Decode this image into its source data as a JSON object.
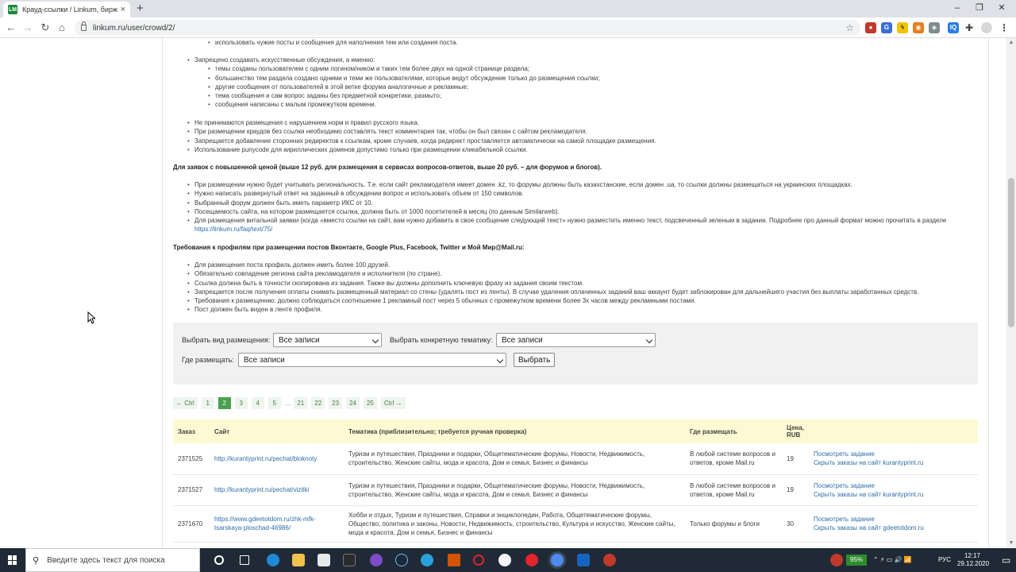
{
  "browser": {
    "tab_title": "Крауд-ссылки / Linkum, биржа",
    "url": "linkum.ru/user/crowd/2/",
    "favicon_text": "LM"
  },
  "page": {
    "top_bullet": "использовать чужие посты и сообщения для наполнения тем или создания поста.",
    "rule_artificial": "Запрещено создавать искусственные обсуждения, а именно:",
    "artificial_items": [
      "темы созданы пользователем с одним логином/ником и таких тем более двух на одной странице раздела;",
      "большинство тем раздела создано одними и теми же пользователями, которые ведут обсуждение только до размещения ссылки;",
      "другие сообщения от пользователей в этой ветке форума аналогичные и рекламные;",
      "тема сообщения и сам вопрос заданы без предметной конкретики, размыто;",
      "сообщения написаны с малым промежутком времени."
    ],
    "general_rules": [
      "Не принимаются размещения с нарушением норм и правил русского языка.",
      "При размещении краудов без ссылки необходимо составлять текст комментария так, чтобы он был связан с сайтом рекламодателя.",
      "Запрещается добавление сторонних редиректов к ссылкам, кроме случаев, когда редирект проставляется автоматически на самой площадке размещения.",
      "Использование punycode для кириллических доменов допустимо только при размещении кликабельной ссылки."
    ],
    "premium_heading": "Для заявок с повышенной ценой (выше 12 руб.  для размещения в сервисах вопросов-ответов, выше 20 руб. – для форумов и блогов).",
    "premium_rules": [
      "При размещении нужно будет учитывать региональность. Т.е. если сайт рекламодателя имеет домен .kz, то форумы должны быть казахстанские, если домен .ua, то ссылки должны размещаться на украинских площадках.",
      "Нужно написать развернутый ответ на заданный в обсуждении вопрос и использовать объем от 150 символов.",
      "Выбранный форум должен быть иметь параметр ИКС от 10.",
      "Посещаемость сайта, на котором размещается ссылка, должна быть от 1000 посетителей в месяц (по данным Similarweb)."
    ],
    "premium_last": "Для размещения витальной заявки (когда «вместо ссылки на сайт, вам нужно добавить в свое сообщение следующий текст» нужно разместить именно текст, подсвеченный зеленым в задании. Подробнее про данный формат можно прочитать в разделе",
    "premium_link": "https://linkum.ru/faq/text/75/",
    "social_heading": "Требования к  профилям при размещении постов Вконтакте, Google Plus, Facebook, Twitter и Мой Мир@Mail.ru:",
    "social_rules": [
      "Для размещения поста профиль должен иметь более 100 друзей.",
      "Обязательно совпадение региона сайта рекламодателя и исполнителя (по стране).",
      "Ссылка должна быть в точности скопирована из задания. Также вы должны дополнить ключевую фразу из задания своим текстом.",
      "Запрещается после получения оплаты снимать размещенный материал со стены (удалять пост из ленты). В случае удаления оплаченных заданий ваш аккаунт будет заблокирован для дальнейшего участия без выплаты заработанных средств.",
      "Требования к размещению: должно соблюдаться соотношение 1 рекламный пост через 5 обычных с промежутком времени более 3х часов между рекламными постами.",
      "Пост должен быть виден в ленте профиля."
    ]
  },
  "filters": {
    "type_label": "Выбрать вид размещения:",
    "type_value": "Все записи",
    "topic_label": "Выбрать конкретную тематику:",
    "topic_value": "Все записи",
    "where_label": "Где размещать:",
    "where_value": "Все записи",
    "submit_label": "Выбрать"
  },
  "pager": {
    "prev": "← Ctrl",
    "pages": [
      "1",
      "2",
      "3",
      "4",
      "5"
    ],
    "dots": "...",
    "pages2": [
      "21",
      "22",
      "23",
      "24",
      "25"
    ],
    "next": "Ctrl →",
    "active": "2"
  },
  "table": {
    "headers": {
      "order": "Заказ",
      "site": "Сайт",
      "topic": "Тематика (приблизительно; требуется ручная проверка)",
      "where": "Где размещать",
      "price": "Цена, RUB"
    },
    "rows": [
      {
        "order": "2371525",
        "site": "http://kurantyprint.ru/pechat/bloknoty",
        "topic": "Туризм и путешествия, Праздники и подарки, Общетематические форумы, Новости, Недвижимость, строительство, Женские сайты, мода и красота, Дом и семья, Бизнес и финансы",
        "where": "В любой системе вопросов и ответов, кроме Mail.ru",
        "price": "19",
        "view": "Посмотреть задание",
        "hide": "Скрыть заказы на сайт kurantyprint.ru"
      },
      {
        "order": "2371527",
        "site": "http://kurantyprint.ru/pechat/vizitki",
        "topic": "Туризм и путешествия, Праздники и подарки, Общетематические форумы, Новости, Недвижимость, строительство, Женские сайты, мода и красота, Дом и семья, Бизнес и финансы",
        "where": "В любой системе вопросов и ответов, кроме Mail.ru",
        "price": "19",
        "view": "Посмотреть задание",
        "hide": "Скрыть заказы на сайт kurantyprint.ru"
      },
      {
        "order": "2371670",
        "site": "https://www.gdeetotdom.ru/zhk-mfk-tsarskaya-ploschad-46986/",
        "topic": "Хобби и отдых, Туризм и путешествия, Справки и энциклопедии, Работа, Общетематические форумы, Общество, политика и законы, Новости, Недвижимость, строительство, Культура и искусство, Женские сайты, мода и красота, Дом и семья, Бизнес и финансы",
        "where": "Только форумы и блоги",
        "price": "30",
        "view": "Посмотреть задание",
        "hide": "Скрыть заказы на сайт gdeetotdom.ru"
      }
    ]
  },
  "taskbar": {
    "search_placeholder": "Введите здесь текст для поиска",
    "battery": "95%",
    "lang": "РУС",
    "time": "12:17",
    "date": "29.12.2020"
  }
}
